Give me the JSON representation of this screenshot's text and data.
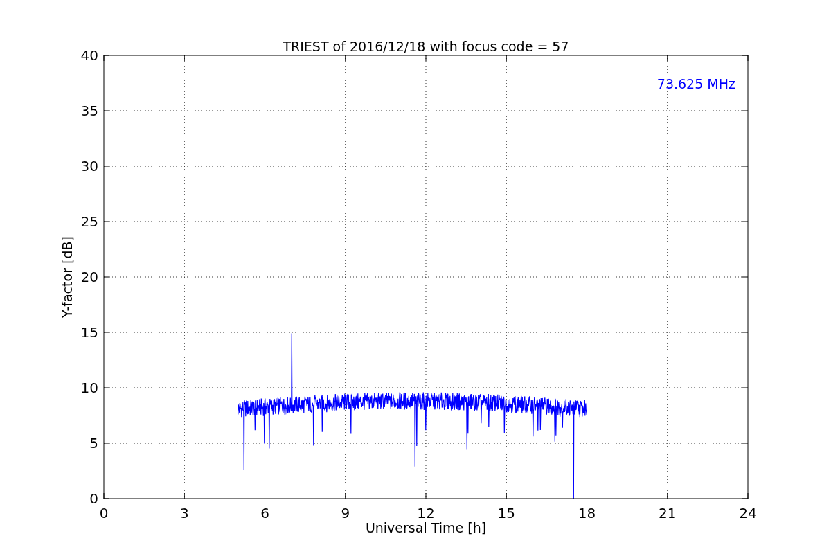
{
  "chart": {
    "title": "TRIEST of 2016/12/18 with focus code = 57",
    "xlabel": "Universal Time [h]",
    "ylabel": "Y-factor [dB]",
    "annotation": "73.625 MHz",
    "xticks": [
      "0",
      "3",
      "6",
      "9",
      "12",
      "15",
      "18",
      "21",
      "24"
    ],
    "yticks": [
      "40",
      "35",
      "30",
      "25",
      "20",
      "15",
      "10",
      "5",
      "0"
    ]
  }
}
